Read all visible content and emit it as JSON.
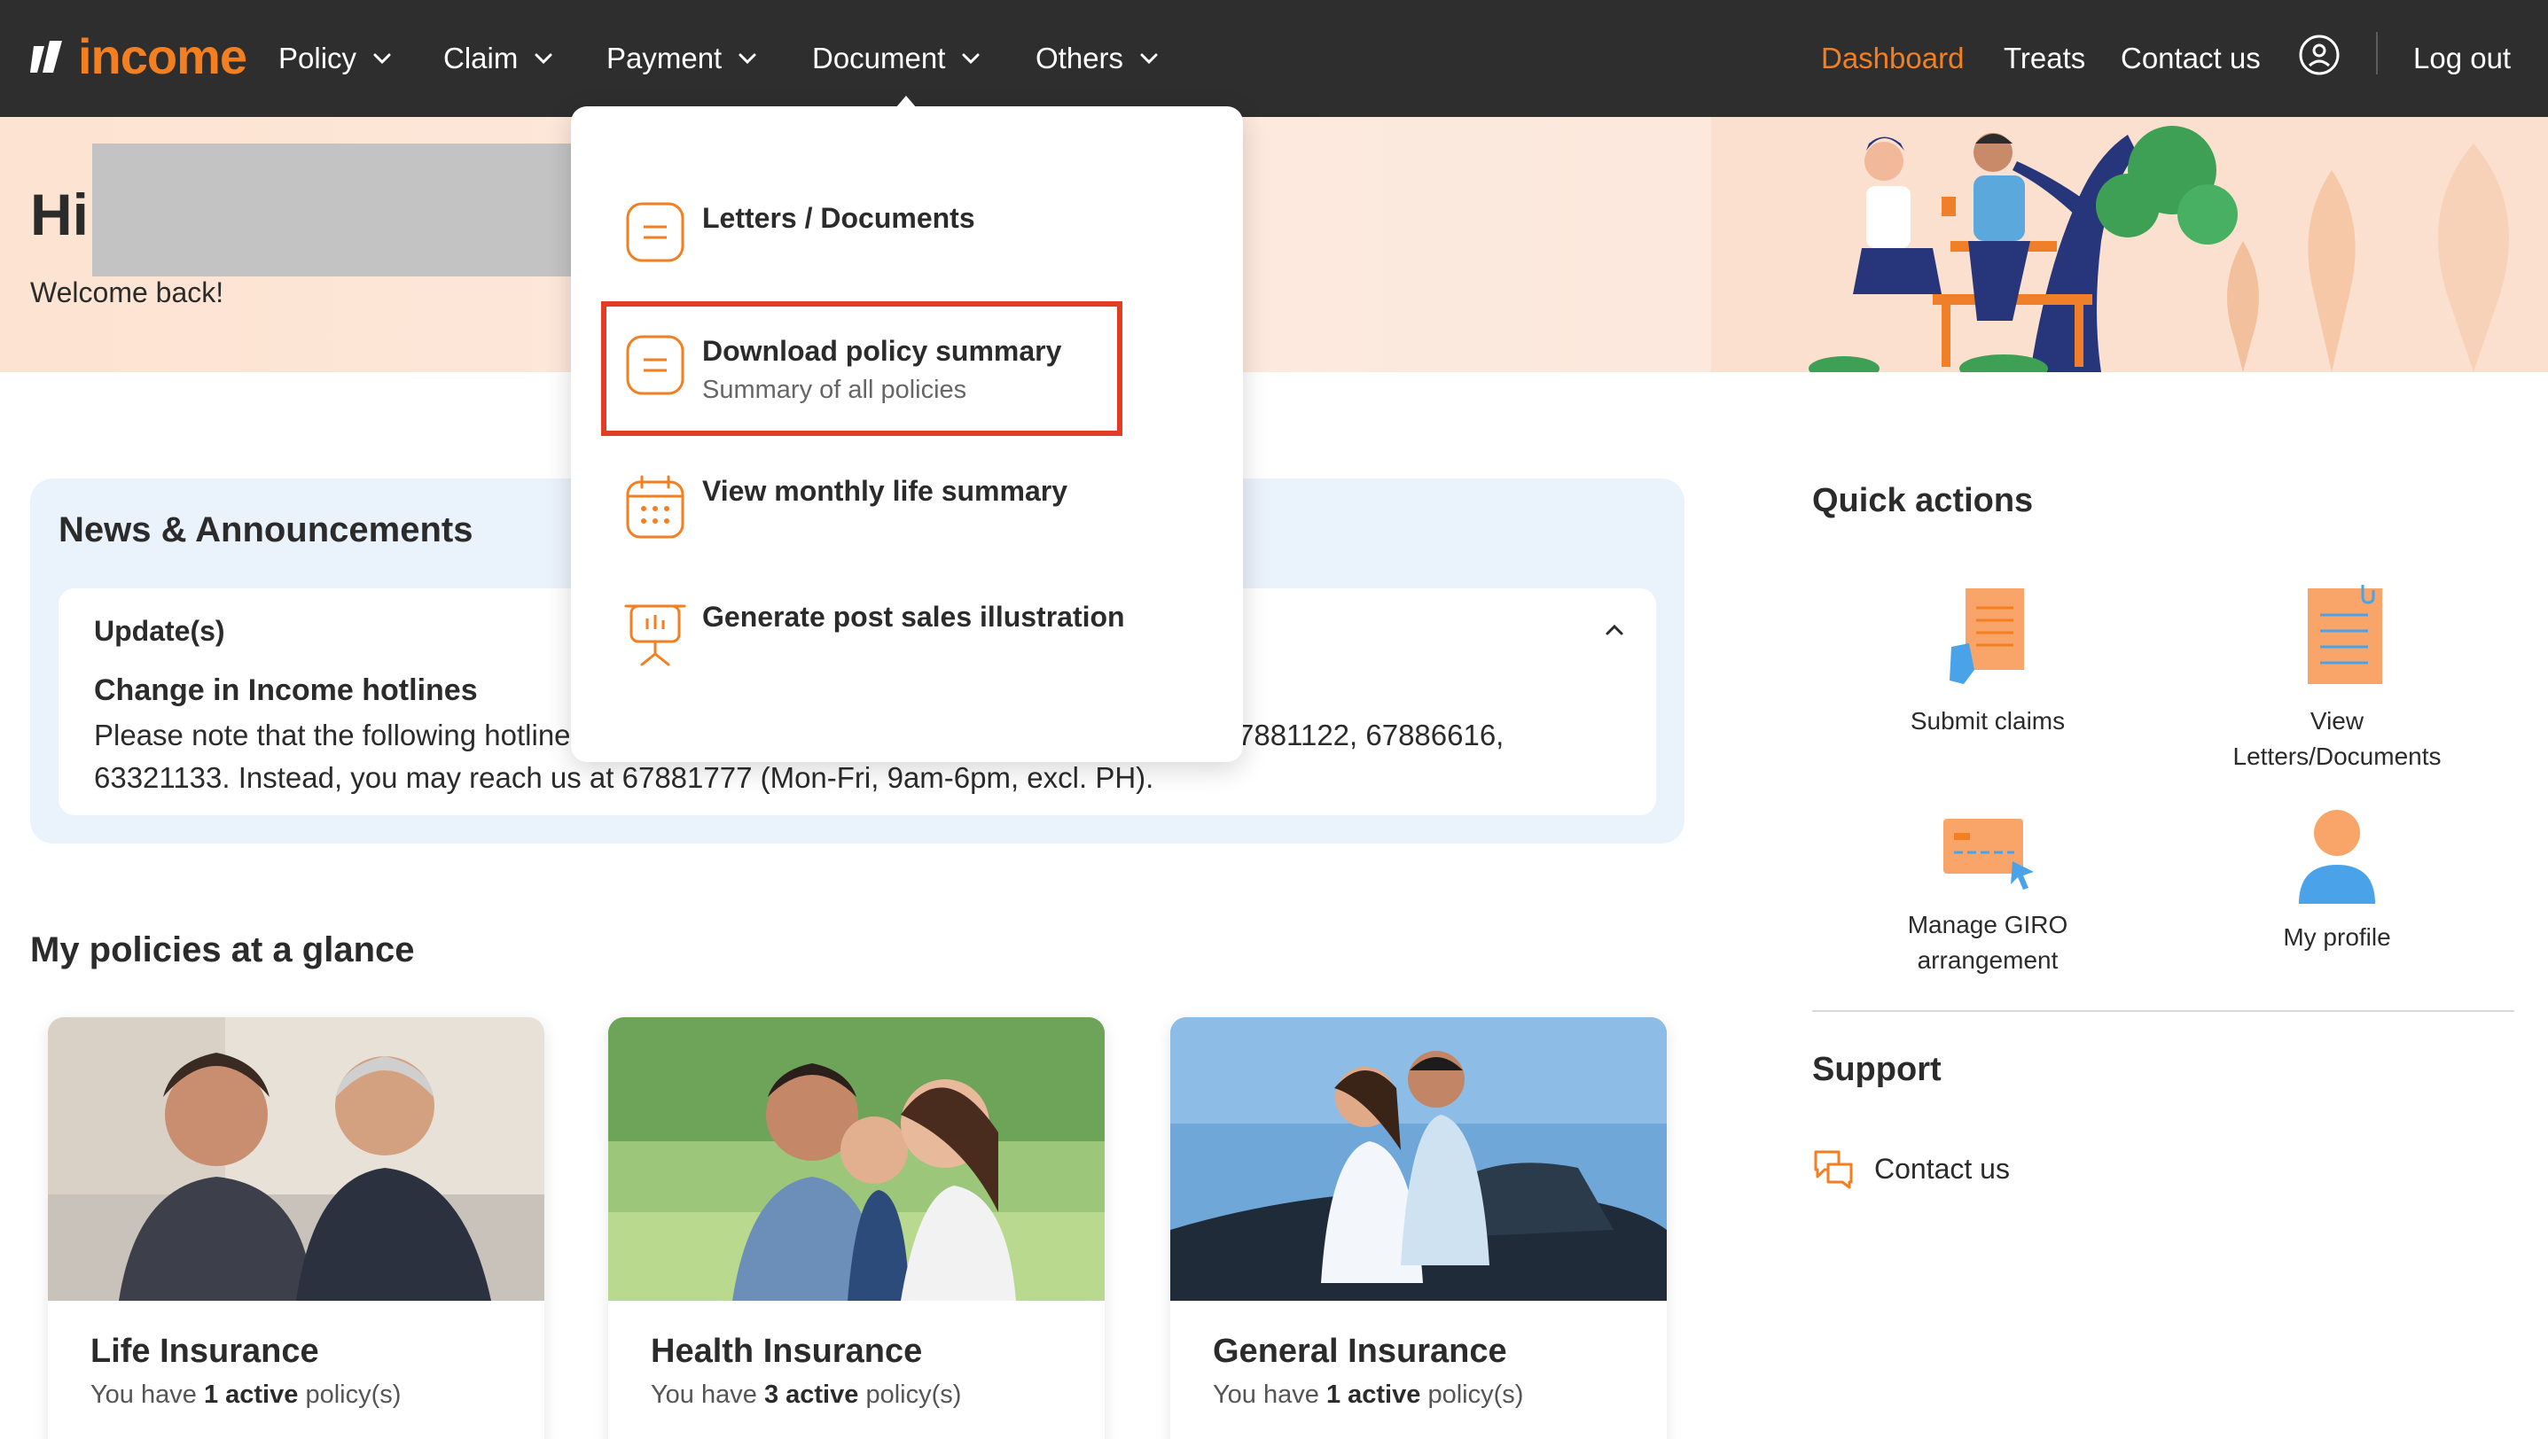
{
  "nav": {
    "brand": "income",
    "menus": [
      {
        "label": "Policy"
      },
      {
        "label": "Claim"
      },
      {
        "label": "Payment"
      },
      {
        "label": "Document"
      },
      {
        "label": "Others"
      }
    ],
    "right_links": {
      "dashboard": "Dashboard",
      "treats": "Treats",
      "contact": "Contact us",
      "logout": "Log out"
    }
  },
  "hero": {
    "greeting": "Hi",
    "welcome": "Welcome back!"
  },
  "dropdown": {
    "items": [
      {
        "title": "Letters / Documents",
        "subtitle": ""
      },
      {
        "title": "Download policy summary",
        "subtitle": "Summary of all policies"
      },
      {
        "title": "View monthly life summary",
        "subtitle": ""
      },
      {
        "title": "Generate post sales illustration",
        "subtitle": ""
      }
    ]
  },
  "news": {
    "title": "News & Announcements",
    "section_label": "Update(s)",
    "headline": "Change in Income hotlines",
    "body_line1_start": "Please note that the following hotline",
    "body_line1_end": "7881122, 67886616,",
    "body_line2": "63321133. Instead, you may reach us at 67881777 (Mon-Fri, 9am-6pm, excl. PH)."
  },
  "policies": {
    "title": "My policies at a glance",
    "cards": [
      {
        "name": "Life Insurance",
        "prefix": "You have",
        "count": "1 active",
        "suffix": "policy(s)"
      },
      {
        "name": "Health Insurance",
        "prefix": "You have",
        "count": "3 active",
        "suffix": "policy(s)"
      },
      {
        "name": "General Insurance",
        "prefix": "You have",
        "count": "1 active",
        "suffix": "policy(s)"
      }
    ]
  },
  "quick_actions": {
    "title": "Quick actions",
    "items": [
      {
        "label": "Submit claims",
        "icon": "claim-form-icon"
      },
      {
        "label_line1": "View",
        "label_line2": "Letters/Documents",
        "icon": "documents-icon"
      },
      {
        "label_line1": "Manage GIRO",
        "label_line2": "arrangement",
        "icon": "card-icon"
      },
      {
        "label": "My profile",
        "icon": "profile-icon"
      }
    ]
  },
  "support": {
    "title": "Support",
    "contact": "Contact us"
  },
  "colors": {
    "accent": "#f47f20",
    "nav_bg": "#2f2e2e",
    "highlight": "#e23b26",
    "news_bg": "#eaf2fb"
  }
}
